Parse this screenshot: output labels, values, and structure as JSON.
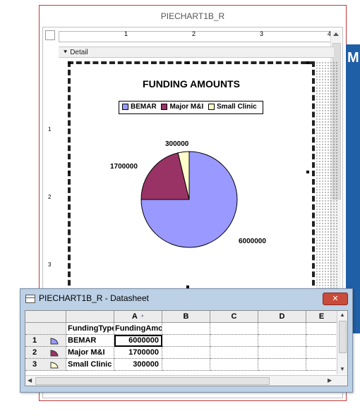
{
  "report": {
    "title": "PIECHART1B_R",
    "section_label": "Detail",
    "ruler_h": [
      "1",
      "2",
      "3",
      "4"
    ],
    "ruler_v": [
      "1",
      "2",
      "3"
    ]
  },
  "side_window": {
    "letter": "M"
  },
  "chart_data": {
    "type": "pie",
    "title": "FUNDING AMOUNTS",
    "categories": [
      "BEMAR",
      "Major M&I",
      "Small Clinic"
    ],
    "values": [
      6000000,
      1700000,
      300000
    ],
    "value_labels": [
      "6000000",
      "1700000",
      "300000"
    ],
    "colors": [
      "#9999ff",
      "#993366",
      "#ffffcc"
    ],
    "legend_position": "top"
  },
  "datasheet": {
    "title": "PIECHART1B_R - Datasheet",
    "close_label": "✕",
    "columns": [
      "A",
      "B",
      "C",
      "D",
      "E"
    ],
    "header_row": [
      "FundingType",
      "FundingAmount"
    ],
    "rows": [
      {
        "num": "1",
        "type": "BEMAR",
        "amount": "6000000"
      },
      {
        "num": "2",
        "type": "Major M&I",
        "amount": "1700000"
      },
      {
        "num": "3",
        "type": "Small Clinic",
        "amount": "300000"
      }
    ]
  }
}
